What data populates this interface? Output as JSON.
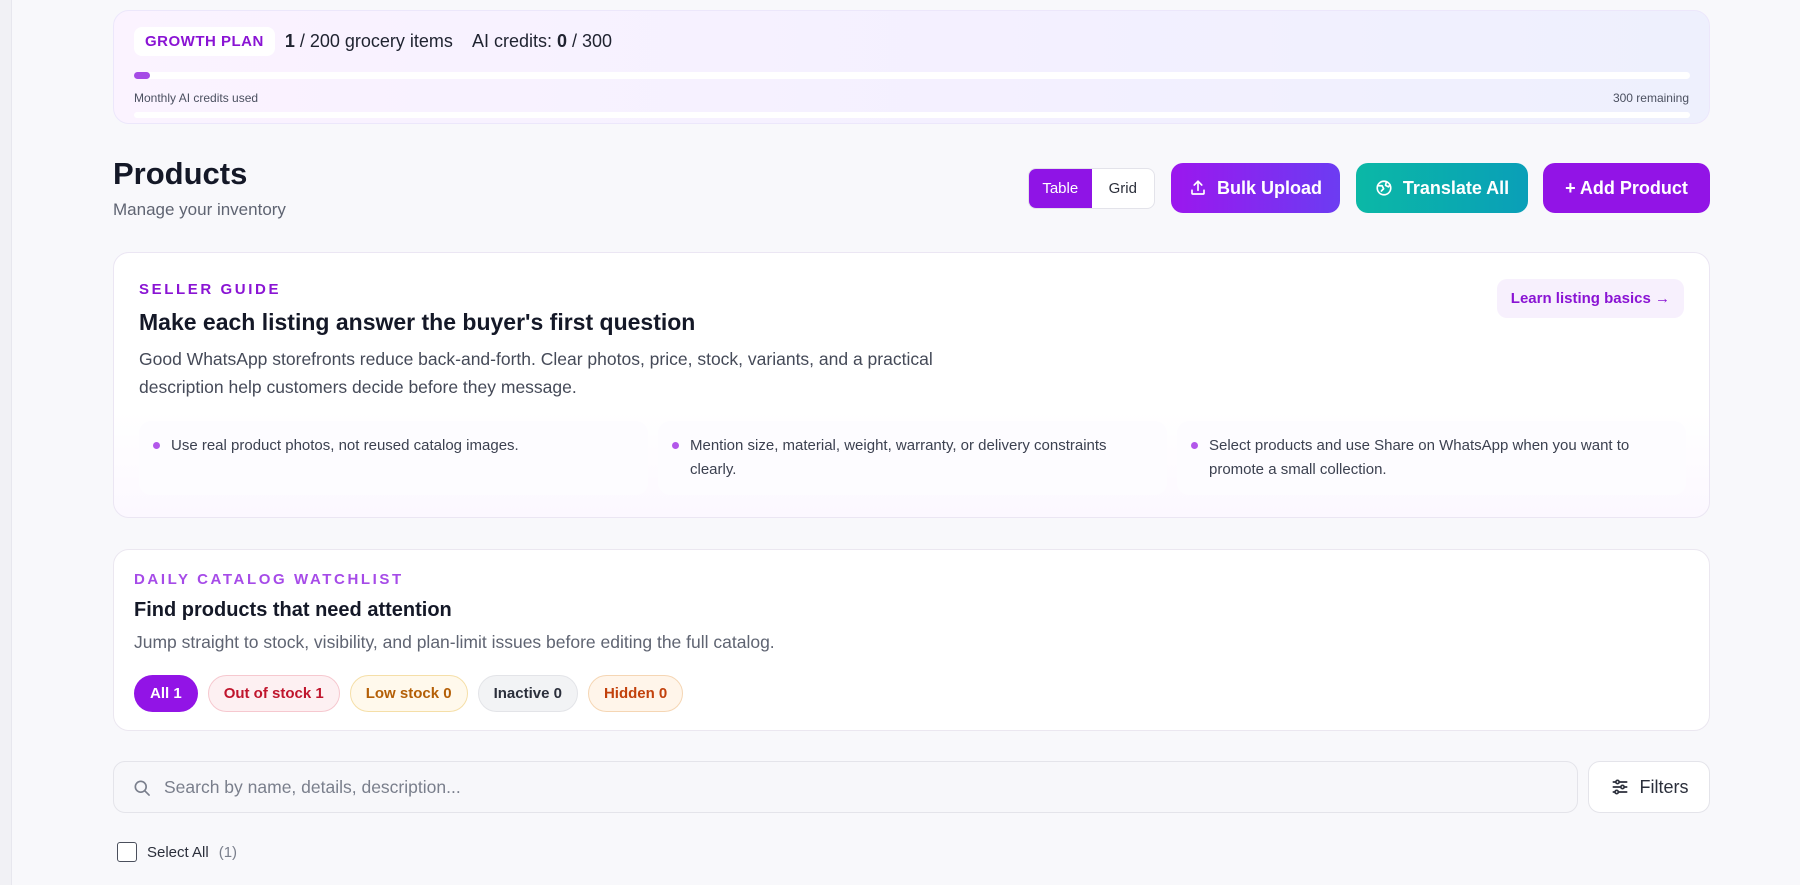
{
  "plan": {
    "badge": "GROWTH PLAN",
    "items_used": "1",
    "items_rest": "/ 200 grocery items",
    "credits_label": "AI credits:",
    "credits_used": "0",
    "credits_rest": "/ 300",
    "credits_fill_fraction": 0.01,
    "caption": "Monthly AI credits used",
    "remaining": "300 remaining"
  },
  "header": {
    "title": "Products",
    "subtitle": "Manage your inventory",
    "view_table": "Table",
    "view_grid": "Grid",
    "active_view": "Table",
    "bulk_upload": "Bulk Upload",
    "translate_all": "Translate All",
    "add_product": "+ Add Product"
  },
  "guide": {
    "eyebrow": "SELLER GUIDE",
    "title": "Make each listing answer the buyer's first question",
    "description": "Good WhatsApp storefronts reduce back-and-forth. Clear photos, price, stock, variants, and a practical description help customers decide before they message.",
    "link": "Learn listing basics →",
    "tips": [
      "Use real product photos, not reused catalog images.",
      "Mention size, material, weight, warranty, or delivery constraints clearly.",
      "Select products and use Share on WhatsApp when you want to promote a small collection."
    ]
  },
  "watchlist": {
    "eyebrow": "DAILY CATALOG WATCHLIST",
    "title": "Find products that need attention",
    "description": "Jump straight to stock, visibility, and plan-limit issues before editing the full catalog.",
    "chips": {
      "all": "All 1",
      "out_of_stock": "Out of stock 1",
      "low_stock": "Low stock 0",
      "inactive": "Inactive 0",
      "hidden": "Hidden 0"
    }
  },
  "search": {
    "placeholder": "Search by name, details, description...",
    "filters": "Filters"
  },
  "selection": {
    "label": "Select All",
    "count": "(1)"
  },
  "colors": {
    "accent": "#9214e6",
    "teal": "#0bb8a6"
  },
  "icons": [
    "upload-icon",
    "translate-icon",
    "search-icon",
    "sliders-icon"
  ]
}
